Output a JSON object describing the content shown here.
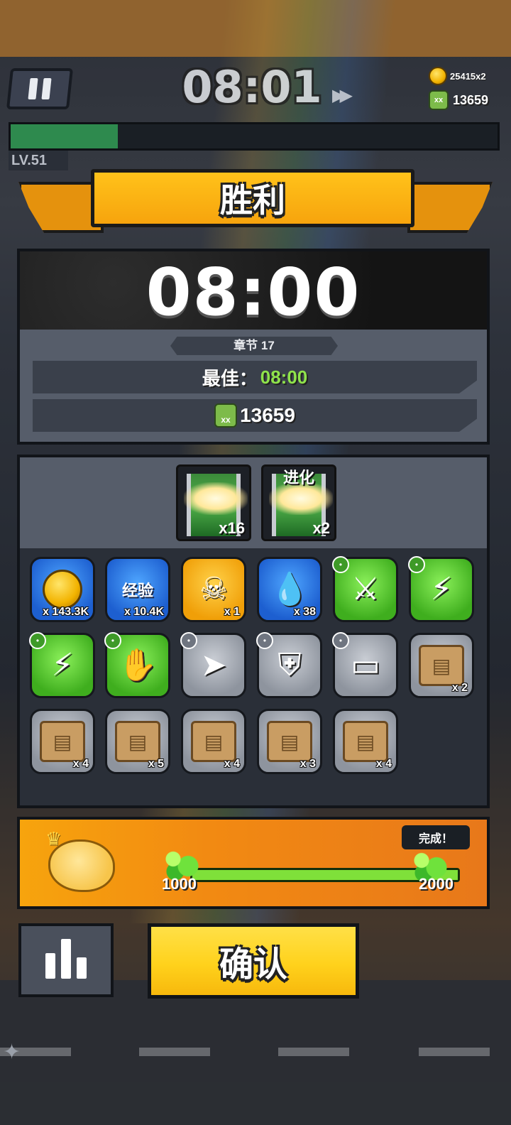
{
  "hud": {
    "timer": "08:01",
    "coins": "25415x2",
    "kills": "13659",
    "level": "LV.51",
    "xp_progress": 0.22
  },
  "result": {
    "banner_title": "胜利",
    "time": "08:00",
    "chapter": "章节 17",
    "best_label": "最佳：",
    "best_value": "08:00",
    "kills_value": "13659"
  },
  "chests": [
    {
      "label": "",
      "count": "x16"
    },
    {
      "label": "进化",
      "count": "x2"
    }
  ],
  "rewards": [
    {
      "icon": "gold-coin-icon",
      "count": "x 143.3K",
      "rarity": "blue",
      "glyph": ""
    },
    {
      "icon": "exp-gem-icon",
      "count": "x 10.4K",
      "rarity": "blue",
      "glyph": "经验"
    },
    {
      "icon": "skull-material-icon",
      "count": "x 1",
      "rarity": "gold",
      "glyph": "☠"
    },
    {
      "icon": "oil-drop-icon",
      "count": "x 38",
      "rarity": "blue",
      "glyph": "💧"
    },
    {
      "icon": "katana-icon",
      "count": "",
      "rarity": "green",
      "glyph": "⚔"
    },
    {
      "icon": "lightning-necklace-icon",
      "count": "",
      "rarity": "green",
      "glyph": "⚡"
    },
    {
      "icon": "lightning-belt-icon",
      "count": "",
      "rarity": "green",
      "glyph": "⚡"
    },
    {
      "icon": "power-glove-icon",
      "count": "",
      "rarity": "green",
      "glyph": "✋"
    },
    {
      "icon": "kunai-icon",
      "count": "",
      "rarity": "gray",
      "glyph": "➤"
    },
    {
      "icon": "armor-vest-icon",
      "count": "",
      "rarity": "gray",
      "glyph": "⛨"
    },
    {
      "icon": "leather-belt-icon",
      "count": "",
      "rarity": "gray",
      "glyph": "▭"
    },
    {
      "icon": "gun-scroll-icon",
      "count": "x 2",
      "rarity": "gray",
      "glyph": "scroll"
    },
    {
      "icon": "armor-scroll-icon",
      "count": "x 4",
      "rarity": "gray",
      "glyph": "scroll"
    },
    {
      "icon": "necklace-scroll-icon",
      "count": "x 5",
      "rarity": "gray",
      "glyph": "scroll"
    },
    {
      "icon": "belt-scroll-icon",
      "count": "x 4",
      "rarity": "gray",
      "glyph": "scroll"
    },
    {
      "icon": "glove-scroll-icon",
      "count": "x 3",
      "rarity": "gray",
      "glyph": "scroll"
    },
    {
      "icon": "boots-scroll-icon",
      "count": "x 4",
      "rarity": "gray",
      "glyph": "scroll"
    }
  ],
  "gem_progress": {
    "start": "1000",
    "end": "2000",
    "done_label": "完成！",
    "fill": 1.0
  },
  "buttons": {
    "confirm": "确认"
  }
}
